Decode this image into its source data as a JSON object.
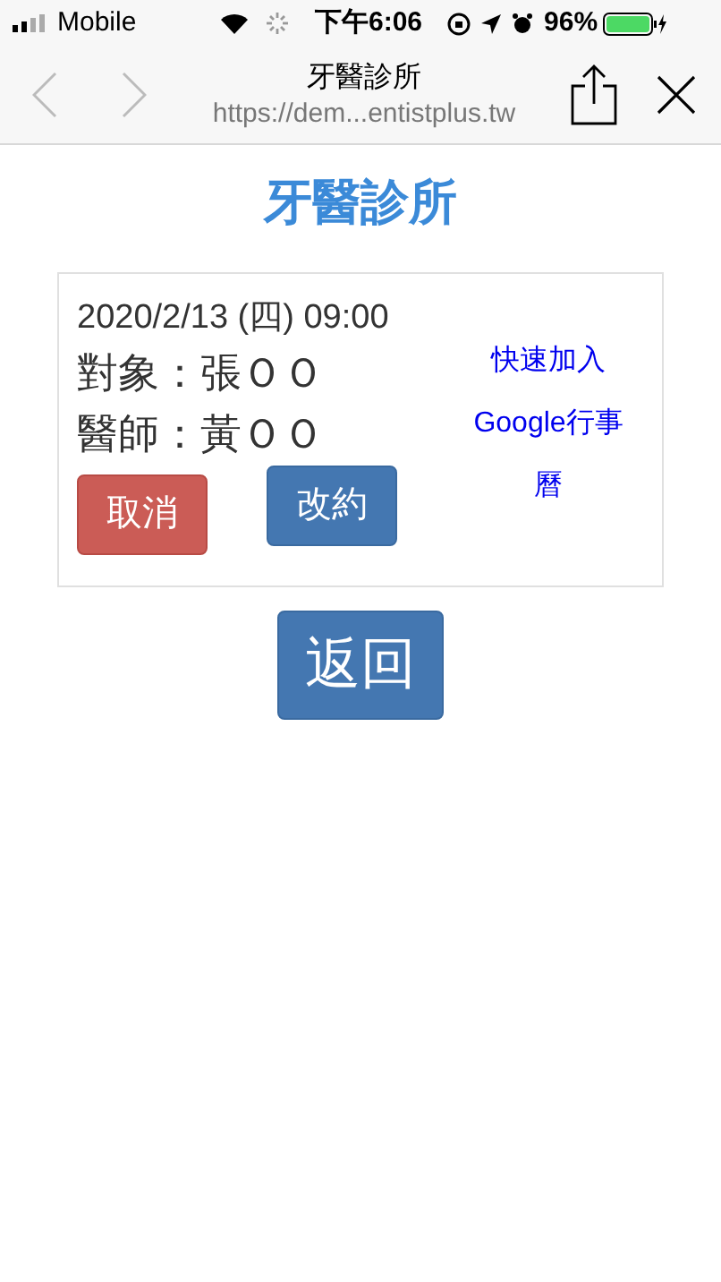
{
  "status_bar": {
    "carrier": "Mobile",
    "time": "下午6:06",
    "battery": "96%"
  },
  "nav_bar": {
    "title": "牙醫診所",
    "url": "https://dem...entistplus.tw",
    "back_disabled": true,
    "forward_disabled": true
  },
  "heading": "牙醫診所",
  "appointment": {
    "datetime": "2020/2/13 (四) 09:00",
    "patient": "對象：張ＯＯ",
    "doctor": "醫師：黃ＯＯ",
    "cancel_button": "取消",
    "reschedule_button": "改約",
    "calendar_link": "快速加入Google行事曆"
  },
  "back_button": "返回"
}
